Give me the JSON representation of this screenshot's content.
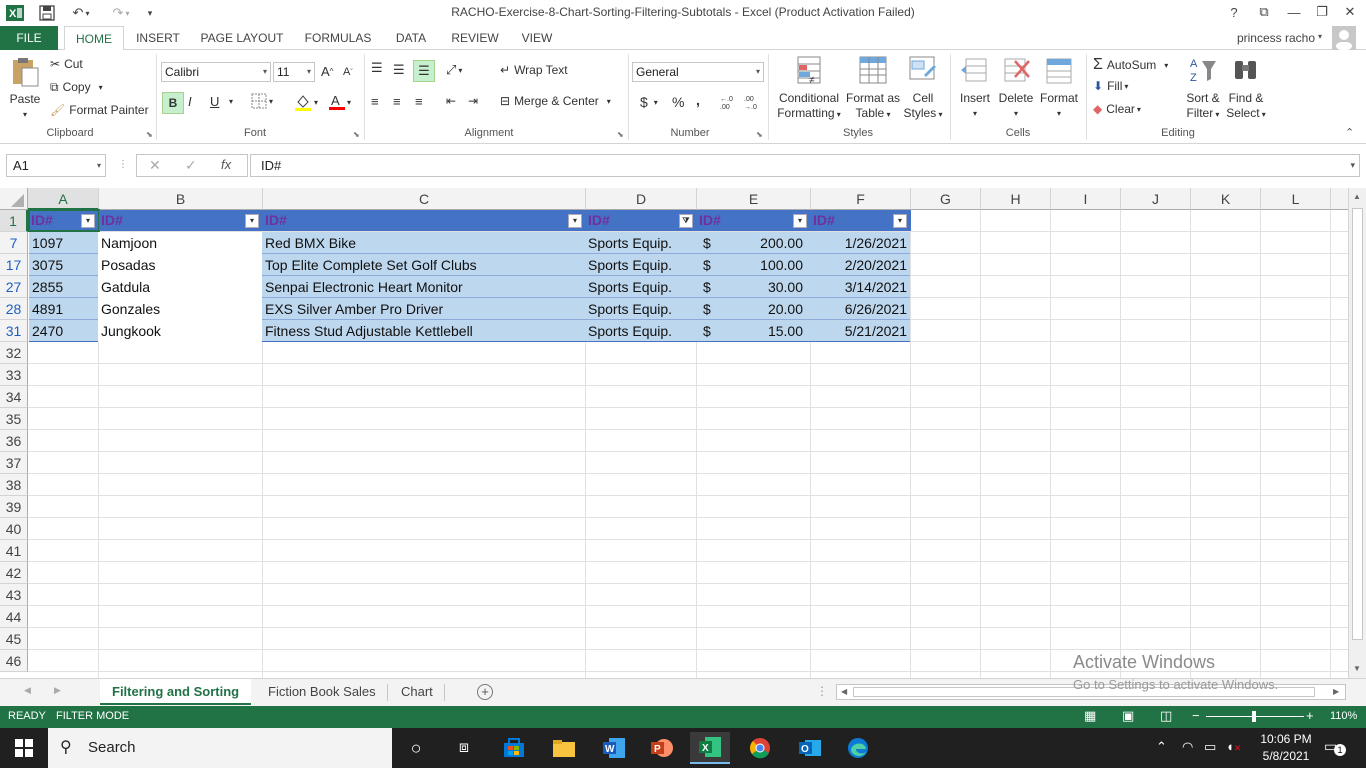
{
  "window": {
    "title": "RACHO-Exercise-8-Chart-Sorting-Filtering-Subtotals - Excel (Product Activation Failed)",
    "user": "princess racho",
    "help": "?"
  },
  "tabs": [
    "FILE",
    "HOME",
    "INSERT",
    "PAGE LAYOUT",
    "FORMULAS",
    "DATA",
    "REVIEW",
    "VIEW"
  ],
  "ribbon": {
    "clipboard": {
      "label": "Clipboard",
      "paste": "Paste",
      "cut": "Cut",
      "copy": "Copy",
      "format_painter": "Format Painter"
    },
    "font": {
      "label": "Font",
      "font_name": "Calibri",
      "font_size": "11",
      "bold": "B",
      "italic": "I",
      "underline": "U"
    },
    "alignment": {
      "label": "Alignment",
      "wrap_text": "Wrap Text",
      "merge_center": "Merge & Center"
    },
    "number": {
      "label": "Number",
      "format": "General",
      "currency": "$",
      "percent": "%",
      "comma": ",",
      "inc_decimal": ".0→.00",
      "dec_decimal": ".00→.0"
    },
    "styles": {
      "label": "Styles",
      "conditional_1": "Conditional",
      "conditional_2": "Formatting",
      "format_table_1": "Format as",
      "format_table_2": "Table",
      "cell_styles_1": "Cell",
      "cell_styles_2": "Styles"
    },
    "cells": {
      "label": "Cells",
      "insert": "Insert",
      "delete": "Delete",
      "format": "Format"
    },
    "editing": {
      "label": "Editing",
      "autosum": "AutoSum",
      "fill": "Fill",
      "clear": "Clear",
      "sort_1": "Sort &",
      "sort_2": "Filter",
      "find_1": "Find &",
      "find_2": "Select"
    }
  },
  "formula_bar": {
    "name_box": "A1",
    "fx": "fx",
    "content": "ID#"
  },
  "columns": [
    "A",
    "B",
    "C",
    "D",
    "E",
    "F",
    "G",
    "H",
    "I",
    "J",
    "K",
    "L"
  ],
  "header_row": {
    "row": "1",
    "cells": [
      "ID#",
      "ID#",
      "ID#",
      "ID#",
      "ID#",
      "ID#"
    ]
  },
  "data_rows": [
    {
      "row": "7",
      "a": "1097",
      "b": "Namjoon",
      "c": "Red BMX Bike",
      "d": "Sports Equip.",
      "cur": "$",
      "e": "200.00",
      "f": "1/26/2021"
    },
    {
      "row": "17",
      "a": "3075",
      "b": "Posadas",
      "c": "Top Elite Complete Set Golf Clubs",
      "d": "Sports Equip.",
      "cur": "$",
      "e": "100.00",
      "f": "2/20/2021"
    },
    {
      "row": "27",
      "a": "2855",
      "b": "Gatdula",
      "c": "Senpai Electronic Heart Monitor",
      "d": "Sports Equip.",
      "cur": "$",
      "e": "30.00",
      "f": "3/14/2021"
    },
    {
      "row": "28",
      "a": "4891",
      "b": "Gonzales",
      "c": "EXS Silver Amber Pro Driver",
      "d": "Sports Equip.",
      "cur": "$",
      "e": "20.00",
      "f": "6/26/2021"
    },
    {
      "row": "31",
      "a": "2470",
      "b": "Jungkook",
      "c": "Fitness Stud Adjustable Kettlebell",
      "d": "Sports Equip.",
      "cur": "$",
      "e": "15.00",
      "f": "5/21/2021"
    }
  ],
  "empty_rows": [
    "32",
    "33",
    "34",
    "35",
    "36",
    "37",
    "38",
    "39",
    "40",
    "41",
    "42",
    "43",
    "44",
    "45",
    "46"
  ],
  "sheets": [
    "Filtering and Sorting",
    "Fiction Book Sales",
    "Chart"
  ],
  "status": {
    "ready": "READY",
    "mode": "FILTER MODE",
    "zoom": "110%"
  },
  "watermark": {
    "line1": "Activate Windows",
    "line2": "Go to Settings to activate Windows."
  },
  "taskbar": {
    "search": "Search",
    "time": "10:06 PM",
    "date": "5/8/2021",
    "notif": "1"
  },
  "colors": {
    "excel_green": "#217346",
    "table_header": "#4472c4",
    "band": "#bdd7ee",
    "header_text": "#7030a0"
  }
}
